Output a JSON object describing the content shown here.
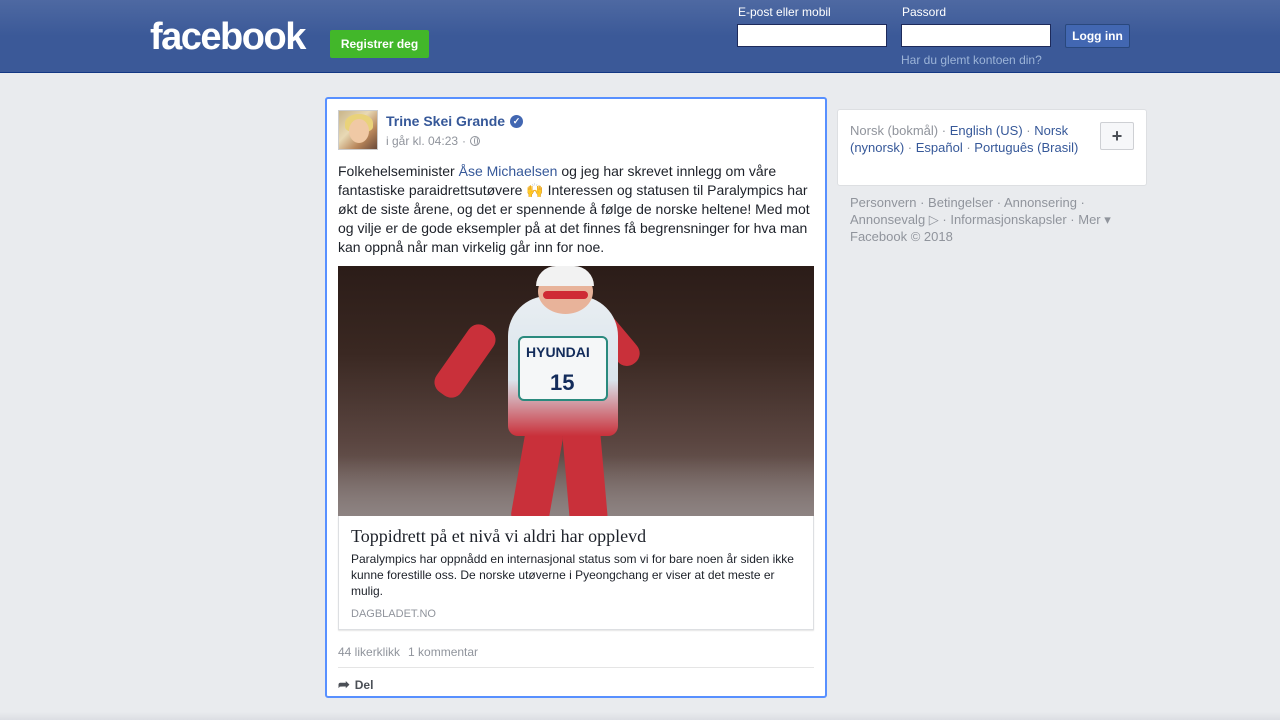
{
  "header": {
    "logo": "facebook",
    "register_label": "Registrer deg",
    "email_label": "E-post eller mobil",
    "email_value": "",
    "password_label": "Passord",
    "password_value": "",
    "login_label": "Logg inn",
    "forgot_label": "Har du glemt kontoen din?"
  },
  "post": {
    "author": "Trine Skei Grande",
    "timestamp": "i går kl. 04:23",
    "text_before_link": "Folkehelseminister ",
    "text_link": "Åse Michaelsen",
    "text_after_link": " og jeg har skrevet innlegg om våre fantastiske paraidrettsutøvere 🙌 Interessen og statusen til Paralympics har økt de siste årene, og det er spennende å følge de norske heltene! Med mot og vilje er de gode eksempler på at det finnes få begrensninger for hva man kan oppnå når man virkelig går inn for noe.",
    "image": {
      "bib_sponsor": "HYUNDAI",
      "bib_number": "15"
    },
    "link": {
      "title": "Toppidrett på et nivå vi aldri har opplevd",
      "description": "Paralympics har oppnådd en internasjonal status som vi for bare noen år siden ikke kunne forestille oss. De norske utøverne i Pyeongchang er viser at det meste er mulig.",
      "source": "DAGBLADET.NO"
    },
    "likes": "44 likerklikk",
    "comments": "1 kommentar",
    "share_label": "Del"
  },
  "languages": {
    "current": "Norsk (bokmål)",
    "options": [
      "English (US)",
      "Norsk (nynorsk)",
      "Español",
      "Português (Brasil)"
    ],
    "add_label": "+"
  },
  "footer": {
    "links": [
      "Personvern",
      "Betingelser",
      "Annonsering",
      "Annonsevalg",
      "Informasjonskapsler",
      "Mer"
    ],
    "copyright": "Facebook © 2018"
  },
  "colors": {
    "header_bg": "#3b5998",
    "register_green": "#42b72a",
    "link_blue": "#365899",
    "focus_border": "#5890ff"
  }
}
